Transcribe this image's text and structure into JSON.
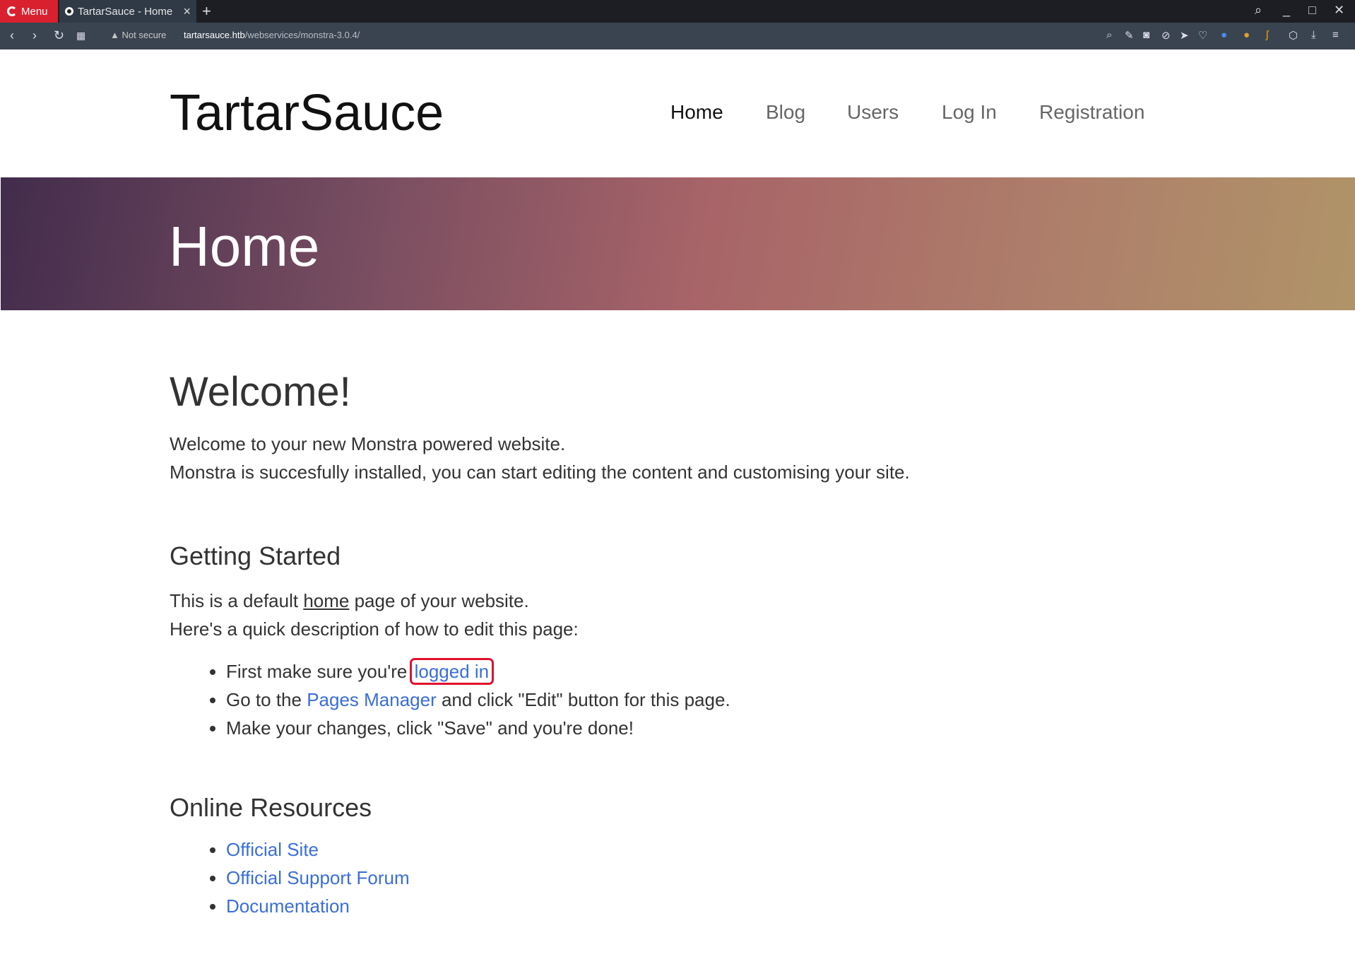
{
  "browser": {
    "menu_label": "Menu",
    "tab_title": "TartarSauce - Home",
    "new_tab": "+",
    "security": "Not secure",
    "url_host": "tartarsauce.htb",
    "url_path": "/webservices/monstra-3.0.4/"
  },
  "site": {
    "brand": "TartarSauce",
    "nav": [
      "Home",
      "Blog",
      "Users",
      "Log In",
      "Registration"
    ],
    "hero_title": "Home"
  },
  "content": {
    "welcome_heading": "Welcome!",
    "welcome_line1": "Welcome to your new Monstra powered website.",
    "welcome_line2": "Monstra is succesfully installed, you can start editing the content and customising your site.",
    "getting_started_heading": "Getting Started",
    "gs_line1_pre": "This is a default ",
    "gs_line1_link": "home",
    "gs_line1_post": " page of your website.",
    "gs_line2": "Here's a quick description of how to edit this page:",
    "step1_pre": "First make sure you're ",
    "step1_link": "logged in",
    "step2_pre": "Go to the ",
    "step2_link": "Pages Manager",
    "step2_post": " and click \"Edit\" button for this page.",
    "step3": "Make your changes, click \"Save\" and you're done!",
    "resources_heading": "Online Resources",
    "resources": [
      "Official Site",
      "Official Support Forum",
      "Documentation"
    ]
  },
  "colors": {
    "link": "#3a6ed8",
    "highlight": "#e0102c",
    "menu_red": "#d9202e"
  }
}
